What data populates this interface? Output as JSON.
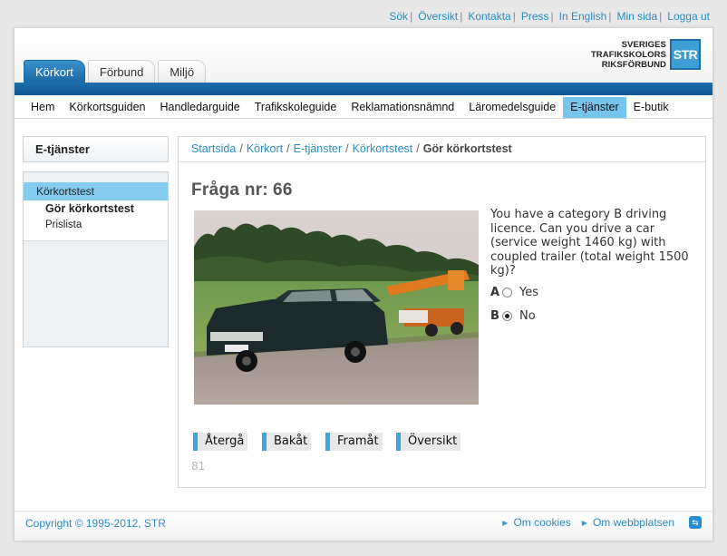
{
  "top_links": [
    "Sök",
    "Översikt",
    "Kontakta",
    "Press",
    "In English",
    "Min sida",
    "Logga ut"
  ],
  "logo": {
    "line1": "SVERIGES",
    "line2": "TRAFIKSKOLORS",
    "line3": "RIKSFÖRBUND",
    "badge": "STR"
  },
  "tabs": [
    {
      "label": "Körkort",
      "active": true
    },
    {
      "label": "Förbund",
      "active": false
    },
    {
      "label": "Miljö",
      "active": false
    }
  ],
  "nav": [
    {
      "label": "Hem"
    },
    {
      "label": "Körkortsguiden"
    },
    {
      "label": "Handledarguide"
    },
    {
      "label": "Trafikskoleguide"
    },
    {
      "label": "Reklamationsnämnd"
    },
    {
      "label": "Läromedelsguide"
    },
    {
      "label": "E-tjänster",
      "active": true
    },
    {
      "label": "E-butik"
    }
  ],
  "sidebar": {
    "title": "E-tjänster",
    "items": [
      {
        "label": "Körkortstest"
      },
      {
        "label": "Gör körkortstest"
      },
      {
        "label": "Prislista"
      }
    ]
  },
  "breadcrumb": {
    "items": [
      "Startsida",
      "Körkort",
      "E-tjänster",
      "Körkortstest"
    ],
    "current": "Gör körkortstest"
  },
  "question": {
    "label": "Fråga nr:",
    "number": "66",
    "text": "You have a category B driving licence. Can you drive a car (service weight 1460 kg) with coupled trailer (total weight 1500 kg)?",
    "answers": [
      {
        "letter": "A",
        "text": "Yes",
        "selected": false
      },
      {
        "letter": "B",
        "text": "No",
        "selected": true
      }
    ]
  },
  "buttons": {
    "back": "Återgå",
    "previous": "Bakåt",
    "next": "Framåt",
    "overview": "Översikt"
  },
  "counter": "81",
  "footer": {
    "copyright": "Copyright © 1995-2012, STR",
    "links": [
      "Om cookies",
      "Om webbplatsen"
    ]
  },
  "colors": {
    "accent": "#1a68a6",
    "link": "#2b8cbf",
    "highlight": "#76c4ec"
  }
}
